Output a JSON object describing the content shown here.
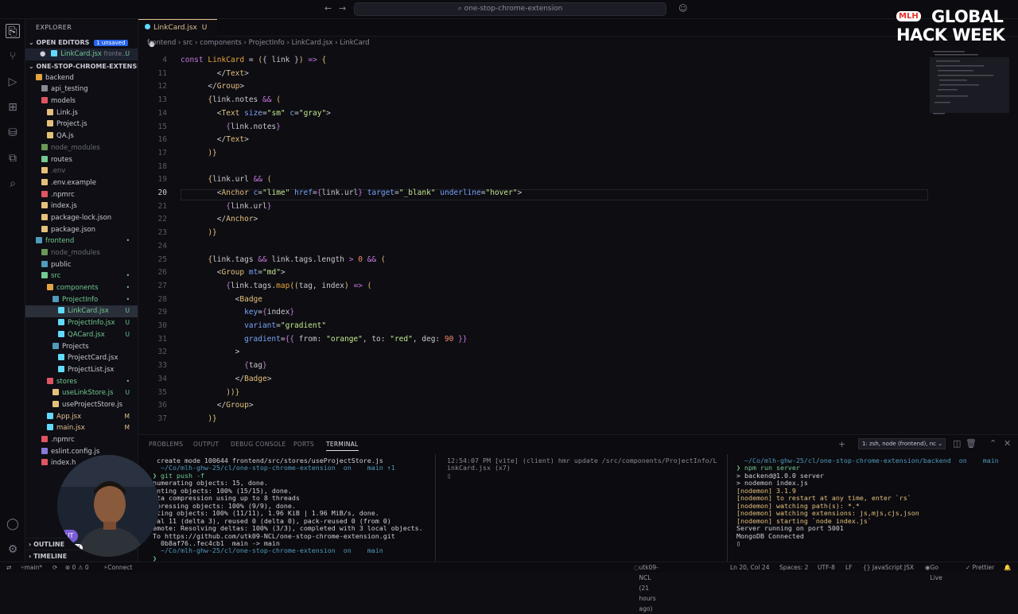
{
  "titlebar": {
    "search_text": "one-stop-chrome-extension"
  },
  "explorer": {
    "header": "EXPLORER",
    "open_editors": {
      "label": "OPEN EDITORS",
      "badge": "1 unsaved",
      "file": "LinkCard.jsx",
      "path": "fronte...",
      "status": "U"
    },
    "project": "ONE-STOP-CHROME-EXTENSION",
    "tree": [
      {
        "label": "backend",
        "depth": 1,
        "cls": "c-dir",
        "icon": "#e2a340",
        "badge": ""
      },
      {
        "label": "api_testing",
        "depth": 2,
        "cls": "c-dir",
        "icon": "#8a8a96",
        "badge": ""
      },
      {
        "label": "models",
        "depth": 2,
        "cls": "c-dir",
        "icon": "#e05561",
        "badge": ""
      },
      {
        "label": "Link.js",
        "depth": 3,
        "cls": "c-norm",
        "icon": "#e5c07b",
        "badge": ""
      },
      {
        "label": "Project.js",
        "depth": 3,
        "cls": "c-norm",
        "icon": "#e5c07b",
        "badge": ""
      },
      {
        "label": "QA.js",
        "depth": 3,
        "cls": "c-norm",
        "icon": "#e5c07b",
        "badge": ""
      },
      {
        "label": "node_modules",
        "depth": 2,
        "cls": "c-ign",
        "icon": "#6a9955",
        "badge": ""
      },
      {
        "label": "routes",
        "depth": 2,
        "cls": "c-dir",
        "icon": "#73c991",
        "badge": ""
      },
      {
        "label": ".env",
        "depth": 2,
        "cls": "c-ign",
        "icon": "#e5c07b",
        "badge": ""
      },
      {
        "label": ".env.example",
        "depth": 2,
        "cls": "c-norm",
        "icon": "#e5c07b",
        "badge": ""
      },
      {
        "label": ".npmrc",
        "depth": 2,
        "cls": "c-norm",
        "icon": "#e05561",
        "badge": ""
      },
      {
        "label": "index.js",
        "depth": 2,
        "cls": "c-norm",
        "icon": "#e5c07b",
        "badge": ""
      },
      {
        "label": "package-lock.json",
        "depth": 2,
        "cls": "c-norm",
        "icon": "#e5c07b",
        "badge": ""
      },
      {
        "label": "package.json",
        "depth": 2,
        "cls": "c-norm",
        "icon": "#e5c07b",
        "badge": ""
      },
      {
        "label": "frontend",
        "depth": 1,
        "cls": "c-unt",
        "icon": "#519aba",
        "badge": "•"
      },
      {
        "label": "node_modules",
        "depth": 2,
        "cls": "c-ign",
        "icon": "#6a9955",
        "badge": ""
      },
      {
        "label": "public",
        "depth": 2,
        "cls": "c-dir",
        "icon": "#519aba",
        "badge": ""
      },
      {
        "label": "src",
        "depth": 2,
        "cls": "c-unt",
        "icon": "#73c991",
        "badge": "•"
      },
      {
        "label": "components",
        "depth": 3,
        "cls": "c-unt",
        "icon": "#e2a340",
        "badge": "•"
      },
      {
        "label": "ProjectInfo",
        "depth": 4,
        "cls": "c-unt",
        "icon": "#519aba",
        "badge": "•"
      },
      {
        "label": "LinkCard.jsx",
        "depth": 5,
        "cls": "c-unt",
        "icon": "#61dafb",
        "badge": "U",
        "sel": true
      },
      {
        "label": "ProjectInfo.jsx",
        "depth": 5,
        "cls": "c-unt",
        "icon": "#61dafb",
        "badge": "U"
      },
      {
        "label": "QACard.jsx",
        "depth": 5,
        "cls": "c-unt",
        "icon": "#61dafb",
        "badge": "U"
      },
      {
        "label": "Projects",
        "depth": 4,
        "cls": "c-dir",
        "icon": "#519aba",
        "badge": ""
      },
      {
        "label": "ProjectCard.jsx",
        "depth": 5,
        "cls": "c-norm",
        "icon": "#61dafb",
        "badge": ""
      },
      {
        "label": "ProjectList.jsx",
        "depth": 5,
        "cls": "c-norm",
        "icon": "#61dafb",
        "badge": ""
      },
      {
        "label": "stores",
        "depth": 3,
        "cls": "c-unt",
        "icon": "#e05561",
        "badge": "•"
      },
      {
        "label": "useLinkStore.js",
        "depth": 4,
        "cls": "c-unt",
        "icon": "#e5c07b",
        "badge": "U"
      },
      {
        "label": "useProjectStore.js",
        "depth": 4,
        "cls": "c-norm",
        "icon": "#e5c07b",
        "badge": ""
      },
      {
        "label": "App.jsx",
        "depth": 3,
        "cls": "c-mod",
        "icon": "#61dafb",
        "badge": "M"
      },
      {
        "label": "main.jsx",
        "depth": 3,
        "cls": "c-mod",
        "icon": "#61dafb",
        "badge": "M"
      },
      {
        "label": ".npmrc",
        "depth": 2,
        "cls": "c-norm",
        "icon": "#e05561",
        "badge": ""
      },
      {
        "label": "eslint.config.js",
        "depth": 2,
        "cls": "c-norm",
        "icon": "#8a7ad8",
        "badge": ""
      },
      {
        "label": "index.h",
        "depth": 2,
        "cls": "c-norm",
        "icon": "#e05561",
        "badge": ""
      }
    ],
    "outline": "OUTLINE",
    "timeline": "TIMELINE"
  },
  "tab": {
    "label": "LinkCard.jsx",
    "status": "U"
  },
  "breadcrumb": [
    "frontend",
    "src",
    "components",
    "ProjectInfo",
    "LinkCard.jsx",
    "LinkCard"
  ],
  "editor": {
    "current_line": "20",
    "lines": [
      {
        "n": "4",
        "html": "<span class='kw'>const</span> <span class='fn'>LinkCard</span> <span class='pn'>=</span> <span class='br'>(</span><span class='pn'>{</span> <span class='pn'>link</span> <span class='pn'>}</span><span class='br'>)</span> <span class='kw'>=&gt;</span> <span class='br'>{</span>"
      },
      {
        "n": "11",
        "html": "        <span class='pn'>&lt;/</span><span class='tg'>Text</span><span class='pn'>&gt;</span>"
      },
      {
        "n": "12",
        "html": "      <span class='pn'>&lt;/</span><span class='tg'>Group</span><span class='pn'>&gt;</span>"
      },
      {
        "n": "13",
        "html": "      <span class='br'>{</span><span class='pn'>link.notes</span> <span class='kw'>&amp;&amp;</span> <span class='br'>(</span>"
      },
      {
        "n": "14",
        "html": "        <span class='pn'>&lt;</span><span class='tg'>Text</span> <span class='at'>size</span><span class='pn'>=</span><span class='st'>\"sm\"</span> <span class='at'>c</span><span class='pn'>=</span><span class='st'>\"gray\"</span><span class='pn'>&gt;</span>"
      },
      {
        "n": "15",
        "html": "          <span class='kw'>{</span><span class='pn'>link.notes</span><span class='kw'>}</span>"
      },
      {
        "n": "16",
        "html": "        <span class='pn'>&lt;/</span><span class='tg'>Text</span><span class='pn'>&gt;</span>"
      },
      {
        "n": "17",
        "html": "      <span class='br'>)}</span>"
      },
      {
        "n": "18",
        "html": ""
      },
      {
        "n": "19",
        "html": "      <span class='br'>{</span><span class='pn'>link.url</span> <span class='kw'>&amp;&amp;</span> <span class='br'>(</span>"
      },
      {
        "n": "20",
        "html": "        <span class='pn'>&lt;</span><span class='tg'>Anchor</span> <span class='at'>c</span><span class='pn'>=</span><span class='st'>\"lime\"</span> <span class='at'>href</span><span class='pn'>=</span><span class='kw'>{</span><span class='pn'>link.url</span><span class='kw'>}</span> <span class='at'>target</span><span class='pn'>=</span><span class='st'>\"_blank\"</span> <span class='at'>underline</span><span class='pn'>=</span><span class='st'>\"hover\"</span><span class='pn'>&gt;</span>"
      },
      {
        "n": "21",
        "html": "          <span class='kw'>{</span><span class='pn'>link.url</span><span class='kw'>}</span>"
      },
      {
        "n": "22",
        "html": "        <span class='pn'>&lt;/</span><span class='tg'>Anchor</span><span class='pn'>&gt;</span>"
      },
      {
        "n": "23",
        "html": "      <span class='br'>)}</span>"
      },
      {
        "n": "24",
        "html": ""
      },
      {
        "n": "25",
        "html": "      <span class='br'>{</span><span class='pn'>link.tags</span> <span class='kw'>&amp;&amp;</span> <span class='pn'>link.tags.length</span> <span class='kw'>&gt;</span> <span class='nm'>0</span> <span class='kw'>&amp;&amp;</span> <span class='br'>(</span>"
      },
      {
        "n": "26",
        "html": "        <span class='pn'>&lt;</span><span class='tg'>Group</span> <span class='at'>mt</span><span class='pn'>=</span><span class='st'>\"md\"</span><span class='pn'>&gt;</span>"
      },
      {
        "n": "27",
        "html": "          <span class='kw'>{</span><span class='pn'>link.tags.</span><span class='fn'>map</span><span class='br'>((</span><span class='pn'>tag, index</span><span class='br'>)</span> <span class='kw'>=&gt;</span> <span class='br'>(</span>"
      },
      {
        "n": "28",
        "html": "            <span class='pn'>&lt;</span><span class='tg'>Badge</span>"
      },
      {
        "n": "29",
        "html": "              <span class='at'>key</span><span class='pn'>=</span><span class='kw'>{</span><span class='pn'>index</span><span class='kw'>}</span>"
      },
      {
        "n": "30",
        "html": "              <span class='at'>variant</span><span class='pn'>=</span><span class='st'>\"gradient\"</span>"
      },
      {
        "n": "31",
        "html": "              <span class='at'>gradient</span><span class='pn'>=</span><span class='kw'>{{</span> <span class='pn'>from:</span> <span class='st'>\"orange\"</span><span class='pn'>, to:</span> <span class='st'>\"red\"</span><span class='pn'>, deg:</span> <span class='nm'>90</span> <span class='kw'>}}</span>"
      },
      {
        "n": "32",
        "html": "            <span class='pn'>&gt;</span>"
      },
      {
        "n": "33",
        "html": "              <span class='kw'>{</span><span class='pn'>tag</span><span class='kw'>}</span>"
      },
      {
        "n": "34",
        "html": "            <span class='pn'>&lt;/</span><span class='tg'>Badge</span><span class='pn'>&gt;</span>"
      },
      {
        "n": "35",
        "html": "          <span class='br'>))}</span>"
      },
      {
        "n": "36",
        "html": "        <span class='pn'>&lt;/</span><span class='tg'>Group</span><span class='pn'>&gt;</span>"
      },
      {
        "n": "37",
        "html": "      <span class='br'>)}</span>"
      }
    ]
  },
  "panel": {
    "tabs": [
      "PROBLEMS",
      "OUTPUT",
      "DEBUG CONSOLE",
      "PORTS",
      "TERMINAL"
    ],
    "active_tab": "TERMINAL",
    "terminal_selector": "1: zsh, node (frontend), nc"
  },
  "terminal_left": [
    " create mode 100644 frontend/src/stores/useProjectStore.js",
    "  ~/Co/mlh-ghw-25/cl/one-stop-chrome-extension  on    main ↑1",
    "❯ git push -f",
    "numerating objects: 15, done.",
    "unting objects: 100% (15/15), done.",
    "lta compression using up to 8 threads",
    "mpressing objects: 100% (9/9), done.",
    "iting objects: 100% (11/11), 1.96 KiB | 1.96 MiB/s, done.",
    "tal 11 (delta 3), reused 0 (delta 0), pack-reused 0 (from 0)",
    "emote: Resolving deltas: 100% (3/3), completed with 3 local objects.",
    "To https://github.com/utk09-NCL/one-stop-chrome-extension.git",
    "  0b8af76..fec4cb1  main -> main",
    "  ~/Co/mlh-ghw-25/cl/one-stop-chrome-extension  on    main",
    "❯ "
  ],
  "terminal_mid": [
    "12:54:07 PM [vite] (client) hmr update /src/components/ProjectInfo/L",
    "inkCard.jsx (x7)",
    "▯"
  ],
  "terminal_right": [
    "  ~/Co/mlh-ghw-25/cl/one-stop-chrome-extension/backend  on    main",
    "❯ npm run server",
    "",
    "> backend@1.0.0 server",
    "> nodemon index.js",
    "",
    "[nodemon] 3.1.9",
    "[nodemon] to restart at any time, enter `rs`",
    "[nodemon] watching path(s): *.*",
    "[nodemon] watching extensions: js,mjs,cjs,json",
    "[nodemon] starting `node index.js`",
    "Server running on port 5001",
    "MongoDB Connected",
    "▯"
  ],
  "statusbar": {
    "branch": "main*",
    "sync": "⟳",
    "problems": "⊗ 0  ⚠ 0",
    "connect": "Connect",
    "git_user": "utk09-NCL (21 hours ago)",
    "position": "Ln 20, Col 24",
    "spaces": "Spaces: 2",
    "encoding": "UTF-8",
    "eol": "LF",
    "language": "{} JavaScript JSX",
    "golive": "Go Live",
    "prettier": "✓ Prettier"
  },
  "overlay": {
    "logo_mark": "MLH",
    "logo_line1": "GLOBAL",
    "logo_line2": "HACK WEEK",
    "avatar_initials": "UT",
    "avatar_tag": "MLH"
  }
}
